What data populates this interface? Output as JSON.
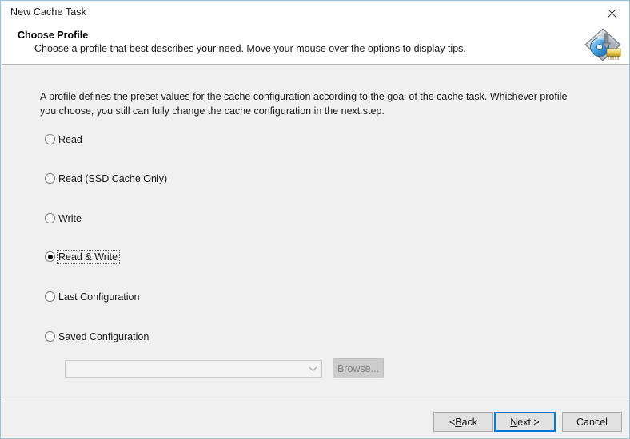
{
  "window": {
    "title": "New Cache Task",
    "close_icon": "close-icon",
    "border_color": "#9bc3d3"
  },
  "header": {
    "title": "Choose Profile",
    "subtitle": "Choose a profile that best describes your need. Move your mouse over the options to display tips.",
    "icon": "cache-task-disc-chip-icon"
  },
  "body": {
    "intro": "A profile defines the preset values for the cache configuration according to the goal of the cache task. Whichever profile you choose, you still can fully change the cache configuration in the next step.",
    "profiles": [
      {
        "label": "Read",
        "selected": false,
        "focused": false
      },
      {
        "label": "Read (SSD Cache Only)",
        "selected": false,
        "focused": false
      },
      {
        "label": "Write",
        "selected": false,
        "focused": false
      },
      {
        "label": "Read & Write",
        "selected": true,
        "focused": true
      },
      {
        "label": "Last Configuration",
        "selected": false,
        "focused": false
      },
      {
        "label": "Saved Configuration",
        "selected": false,
        "focused": false
      }
    ],
    "saved_config_combo": {
      "value": "",
      "placeholder": "",
      "enabled": false,
      "arrow_icon": "chevron-down-icon"
    },
    "browse_button": {
      "label": "Browse...",
      "enabled": false
    }
  },
  "footer": {
    "back_button": {
      "prefix": "< ",
      "accel": "B",
      "suffix": "ack"
    },
    "next_button": {
      "prefix": "",
      "accel": "N",
      "suffix": "ext >"
    },
    "cancel_button": {
      "label": "Cancel"
    }
  },
  "colors": {
    "accent": "#0078d7",
    "window_border": "#9bc3d3",
    "body_background": "#f0f0f0",
    "header_background": "#ffffff",
    "separator": "#b4b4b4"
  }
}
